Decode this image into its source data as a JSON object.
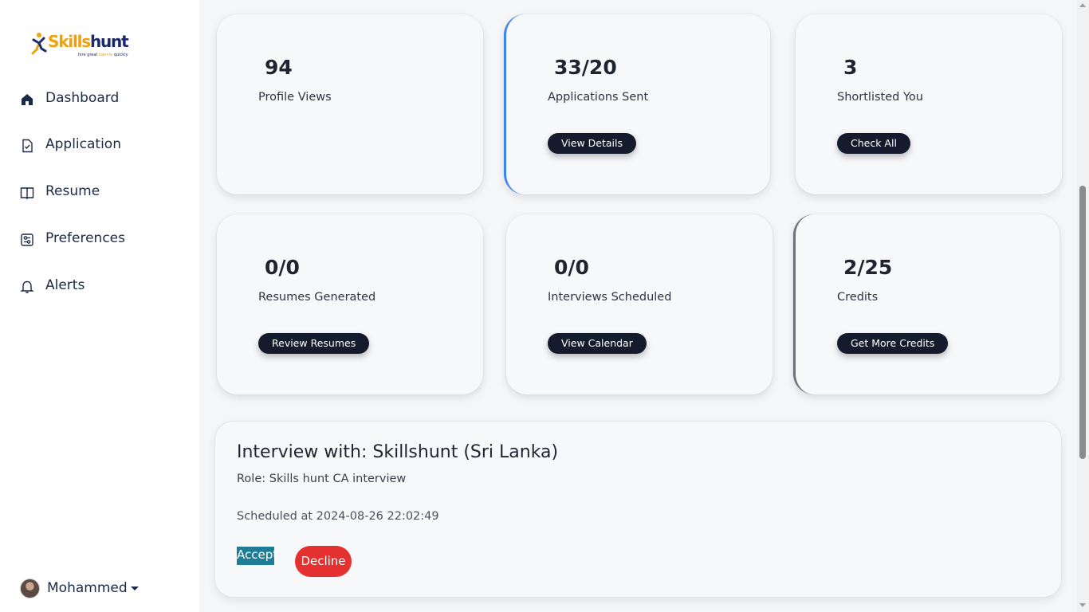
{
  "brand": {
    "name_part1": "Skills",
    "name_part2": "hunt",
    "tagline_pre": "hire great",
    "tagline_highlight": "talents",
    "tagline_post": "quickly",
    "colors": {
      "primary": "#1c2a6b",
      "accent": "#f0a20c"
    }
  },
  "sidebar": {
    "items": [
      {
        "label": "Dashboard",
        "icon": "home-icon"
      },
      {
        "label": "Application",
        "icon": "file-check-icon"
      },
      {
        "label": "Resume",
        "icon": "book-icon"
      },
      {
        "label": "Preferences",
        "icon": "sliders-icon"
      },
      {
        "label": "Alerts",
        "icon": "bell-icon"
      }
    ],
    "user": {
      "name": "Mohammed"
    }
  },
  "stats": [
    {
      "value": "94",
      "caption": "Profile Views",
      "button": ""
    },
    {
      "value": "33/20",
      "caption": "Applications Sent",
      "button": "View Details"
    },
    {
      "value": "3",
      "caption": "Shortlisted You",
      "button": "Check All"
    },
    {
      "value": "0/0",
      "caption": "Resumes Generated",
      "button": "Review Resumes"
    },
    {
      "value": "0/0",
      "caption": "Interviews Scheduled",
      "button": "View Calendar"
    },
    {
      "value": "2/25",
      "caption": "Credits",
      "button": "Get More Credits"
    }
  ],
  "interview": {
    "title": "Interview with: Skillshunt (Sri Lanka)",
    "role": "Role: Skills hunt CA interview",
    "scheduled": "Scheduled at 2024-08-26 22:02:49",
    "accept_label": "Accept",
    "decline_label": "Decline",
    "colors": {
      "accept": "#1e7c94",
      "decline": "#e53030"
    }
  }
}
